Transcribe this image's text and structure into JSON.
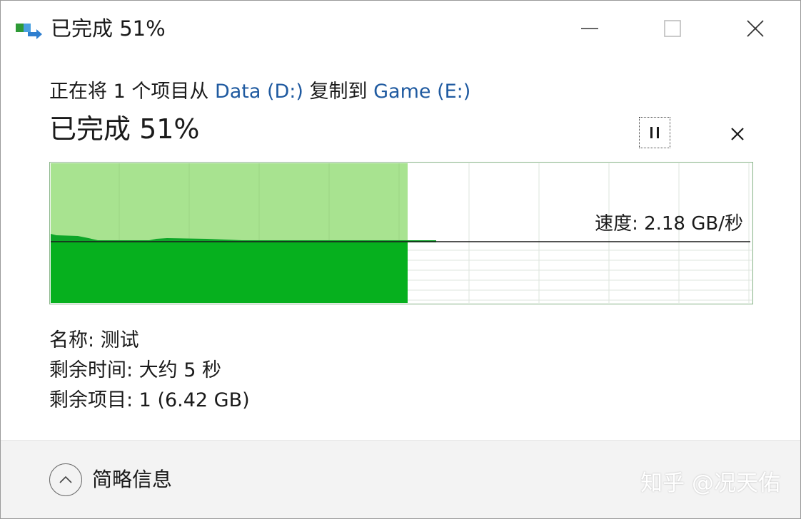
{
  "window": {
    "title": "已完成 51%"
  },
  "titlebar_buttons": {
    "minimize": "minimize-icon",
    "maximize": "maximize-icon",
    "close": "close-icon"
  },
  "copy": {
    "prefix": "正在将 1 个项目从 ",
    "source": "Data (D:)",
    "middle": " 复制到 ",
    "destination": "Game (E:)",
    "progress_label": "已完成 51%",
    "progress_percent": 51
  },
  "speed": {
    "label": "速度: 2.18 GB/秒"
  },
  "details": {
    "name": "名称: 测试",
    "time_remaining": "剩余时间: 大约 5 秒",
    "items_remaining": "剩余项目: 1 (6.42 GB)"
  },
  "footer": {
    "toggle_label": "简略信息",
    "watermark": "知乎 @况天佑"
  },
  "colors": {
    "accent_link": "#1f5aa0",
    "graph_fill_light": "#a8e390",
    "graph_fill_dark": "#06b01e",
    "graph_border": "#7fbf7f",
    "footer_bg": "#f3f3f3"
  }
}
